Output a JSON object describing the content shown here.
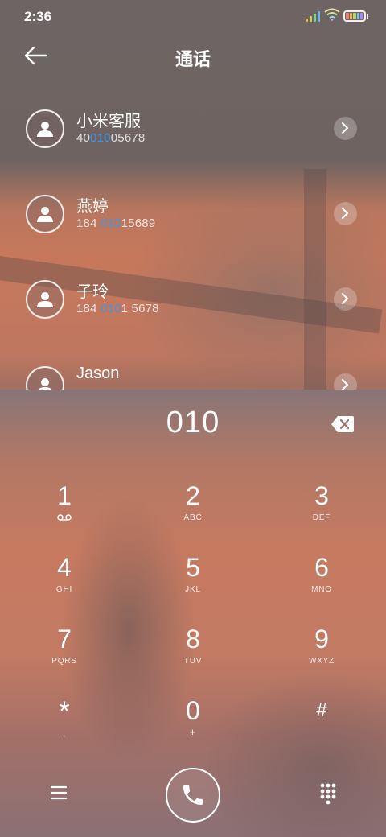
{
  "status": {
    "time": "2:36",
    "signal_colors": [
      "#e6b35a",
      "#c6d05e",
      "#7fd08a",
      "#6fb6e6"
    ],
    "battery_colors": [
      "#e77f7f",
      "#e9b45d",
      "#bcd66a",
      "#75c7e6",
      "#a68be8"
    ]
  },
  "header": {
    "back_icon": "arrow-left-icon",
    "title": "通话"
  },
  "contacts": [
    {
      "name": "小米客服",
      "number_pre": "40",
      "number_hl": "010",
      "number_post": "05678"
    },
    {
      "name": "燕婷",
      "number_pre": "184 ",
      "number_hl": "010",
      "number_post": "15689"
    },
    {
      "name": "子玲",
      "number_pre": "184 ",
      "number_hl": "010",
      "number_post": "1 5678"
    },
    {
      "name": "Jason",
      "number_pre": "",
      "number_hl": "",
      "number_post": ""
    }
  ],
  "colors": {
    "highlight": "#3e97e6",
    "dialer_top": "#887577",
    "accent_orange": "#c67a60"
  },
  "dialer": {
    "input": "010",
    "backspace_icon": "backspace-icon",
    "keys": [
      {
        "digit": "1",
        "sub": "",
        "sub_icon": "voicemail-icon"
      },
      {
        "digit": "2",
        "sub": "ABC"
      },
      {
        "digit": "3",
        "sub": "DEF"
      },
      {
        "digit": "4",
        "sub": "GHI"
      },
      {
        "digit": "5",
        "sub": "JKL"
      },
      {
        "digit": "6",
        "sub": "MNO"
      },
      {
        "digit": "7",
        "sub": "PQRS"
      },
      {
        "digit": "8",
        "sub": "TUV"
      },
      {
        "digit": "9",
        "sub": "WXYZ"
      },
      {
        "digit": "*",
        "sub": ","
      },
      {
        "digit": "0",
        "sub": "+"
      },
      {
        "digit": "#",
        "sub": ""
      }
    ],
    "bottom": {
      "menu_icon": "menu-icon",
      "call_icon": "phone-icon",
      "keypad_icon": "keypad-icon"
    }
  }
}
